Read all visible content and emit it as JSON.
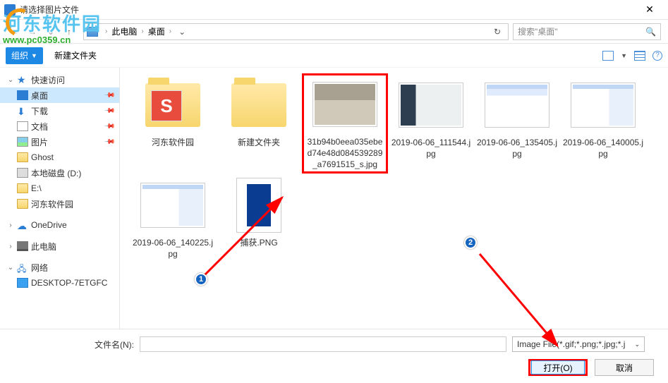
{
  "window": {
    "title": "请选择图片文件"
  },
  "nav": {
    "path_root": "此电脑",
    "path_current": "桌面",
    "search_placeholder": "搜索\"桌面\""
  },
  "toolbar": {
    "organize": "组织",
    "new_folder": "新建文件夹"
  },
  "sidebar": {
    "quick_access": "快速访问",
    "desktop": "桌面",
    "downloads": "下载",
    "documents": "文档",
    "pictures": "图片",
    "ghost": "Ghost",
    "local_disk_d": "本地磁盘 (D:)",
    "e_drive": "E:\\",
    "hedong": "河东软件园",
    "onedrive": "OneDrive",
    "this_pc": "此电脑",
    "network": "网络",
    "desktop_pc": "DESKTOP-7ETGFC"
  },
  "files": [
    {
      "name": "河东软件园",
      "type": "folder-s"
    },
    {
      "name": "新建文件夹",
      "type": "folder"
    },
    {
      "name": "31b94b0eea035ebed74e48d084539289_a7691515_s.jpg",
      "type": "img-dogs",
      "highlighted": true
    },
    {
      "name": "2019-06-06_111544.jpg",
      "type": "img-ui1"
    },
    {
      "name": "2019-06-06_135405.jpg",
      "type": "img-ui2"
    },
    {
      "name": "2019-06-06_140005.jpg",
      "type": "img-ui3"
    },
    {
      "name": "2019-06-06_140225.jpg",
      "type": "img-ui3"
    },
    {
      "name": "捕获.PNG",
      "type": "img-capture"
    }
  ],
  "footer": {
    "filename_label": "文件名(N):",
    "filter": "Image File(*.gif;*.png;*.jpg;*.j",
    "open": "打开(O)",
    "cancel": "取消"
  },
  "watermark": {
    "text": "河东软件园",
    "url": "www.pc0359.cn"
  },
  "annotations": {
    "badge1": "1",
    "badge2": "2"
  }
}
